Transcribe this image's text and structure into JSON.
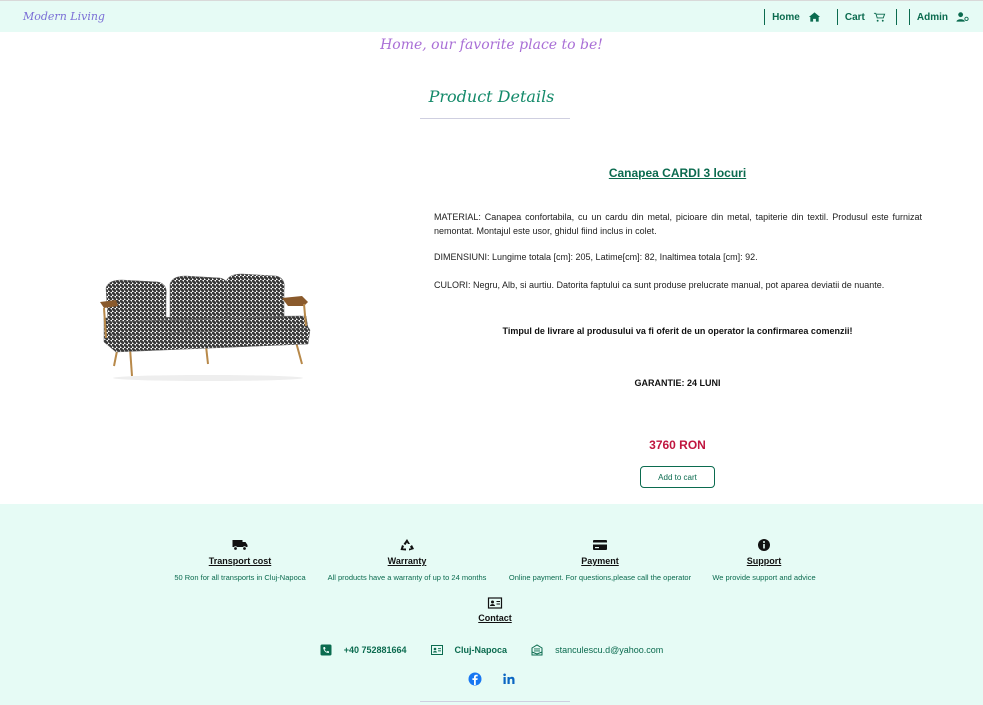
{
  "header": {
    "brand": "Modern Living",
    "nav": [
      {
        "label": "Home",
        "icon": "home-icon"
      },
      {
        "label": "Cart",
        "icon": "cart-icon"
      },
      {
        "label": "Admin",
        "icon": "admin-user-icon"
      }
    ]
  },
  "tagline": "Home, our favorite place to be!",
  "section_title": "Product Details",
  "product": {
    "name": "Canapea CARDI 3 locuri",
    "material": "MATERIAL: Canapea confortabila, cu un cardu din metal, picioare din metal, tapiterie din textil. Produsul este furnizat nemontat. Montajul este usor, ghidul fiind inclus in colet.",
    "dimensions": "DIMENSIUNI: Lungime totala [cm]: 205, Latime[cm]: 82, Inaltimea totala [cm]: 92.",
    "colors": "CULORI: Negru, Alb, si aurtiu. Datorita faptului ca sunt produse prelucrate manual, pot aparea deviatii de nuante.",
    "delivery": "Timpul de livrare al produsului va fi oferit de un operator la confirmarea comenzii!",
    "warranty": "GARANTIE: 24 LUNI",
    "price": "3760 RON",
    "add_to_cart": "Add to cart"
  },
  "footer": {
    "features": [
      {
        "title": "Transport cost",
        "desc": "50 Ron for all transports in Cluj-Napoca",
        "icon": "truck-icon"
      },
      {
        "title": "Warranty",
        "desc": "All products have a warranty of up to 24 months",
        "icon": "recycle-icon"
      },
      {
        "title": "Payment",
        "desc": "Online payment. For questions,please call the operator",
        "icon": "credit-card-icon"
      },
      {
        "title": "Support",
        "desc": "We provide support and advice",
        "icon": "info-icon"
      }
    ],
    "contact_title": "Contact",
    "phone": "+40 752881664",
    "city": "Cluj-Napoca",
    "email": "stanculescu.d@yahoo.com"
  },
  "colors": {
    "primary": "#0b6b4f",
    "footer_bg": "#e6fbf5",
    "price": "#c0163f",
    "tagline": "#a96fd6",
    "facebook": "#1877f2",
    "linkedin": "#0a66c2"
  }
}
